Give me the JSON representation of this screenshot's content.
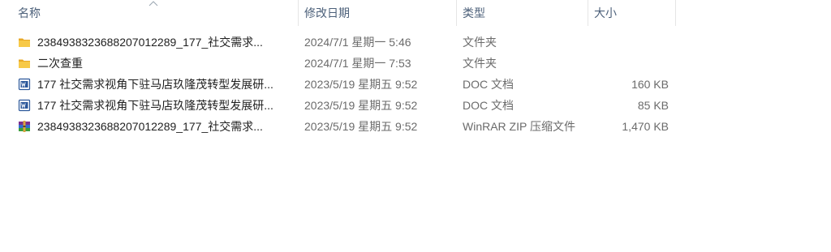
{
  "columns": {
    "name": "名称",
    "date": "修改日期",
    "type": "类型",
    "size": "大小"
  },
  "files": [
    {
      "icon": "folder-icon",
      "name": "2384938323688207012289_177_社交需求...",
      "date": "2024/7/1 星期一 5:46",
      "type": "文件夹",
      "size": ""
    },
    {
      "icon": "folder-icon",
      "name": "二次查重",
      "date": "2024/7/1 星期一 7:53",
      "type": "文件夹",
      "size": ""
    },
    {
      "icon": "word-doc-icon",
      "name": "177 社交需求视角下驻马店玖隆茂转型发展研...",
      "date": "2023/5/19 星期五 9:52",
      "type": "DOC 文档",
      "size": "160 KB"
    },
    {
      "icon": "word-doc-icon",
      "name": "177 社交需求视角下驻马店玖隆茂转型发展研...",
      "date": "2023/5/19 星期五 9:52",
      "type": "DOC 文档",
      "size": "85 KB"
    },
    {
      "icon": "winrar-archive-icon",
      "name": "2384938323688207012289_177_社交需求...",
      "date": "2023/5/19 星期五 9:52",
      "type": "WinRAR ZIP 压缩文件",
      "size": "1,470 KB"
    }
  ]
}
